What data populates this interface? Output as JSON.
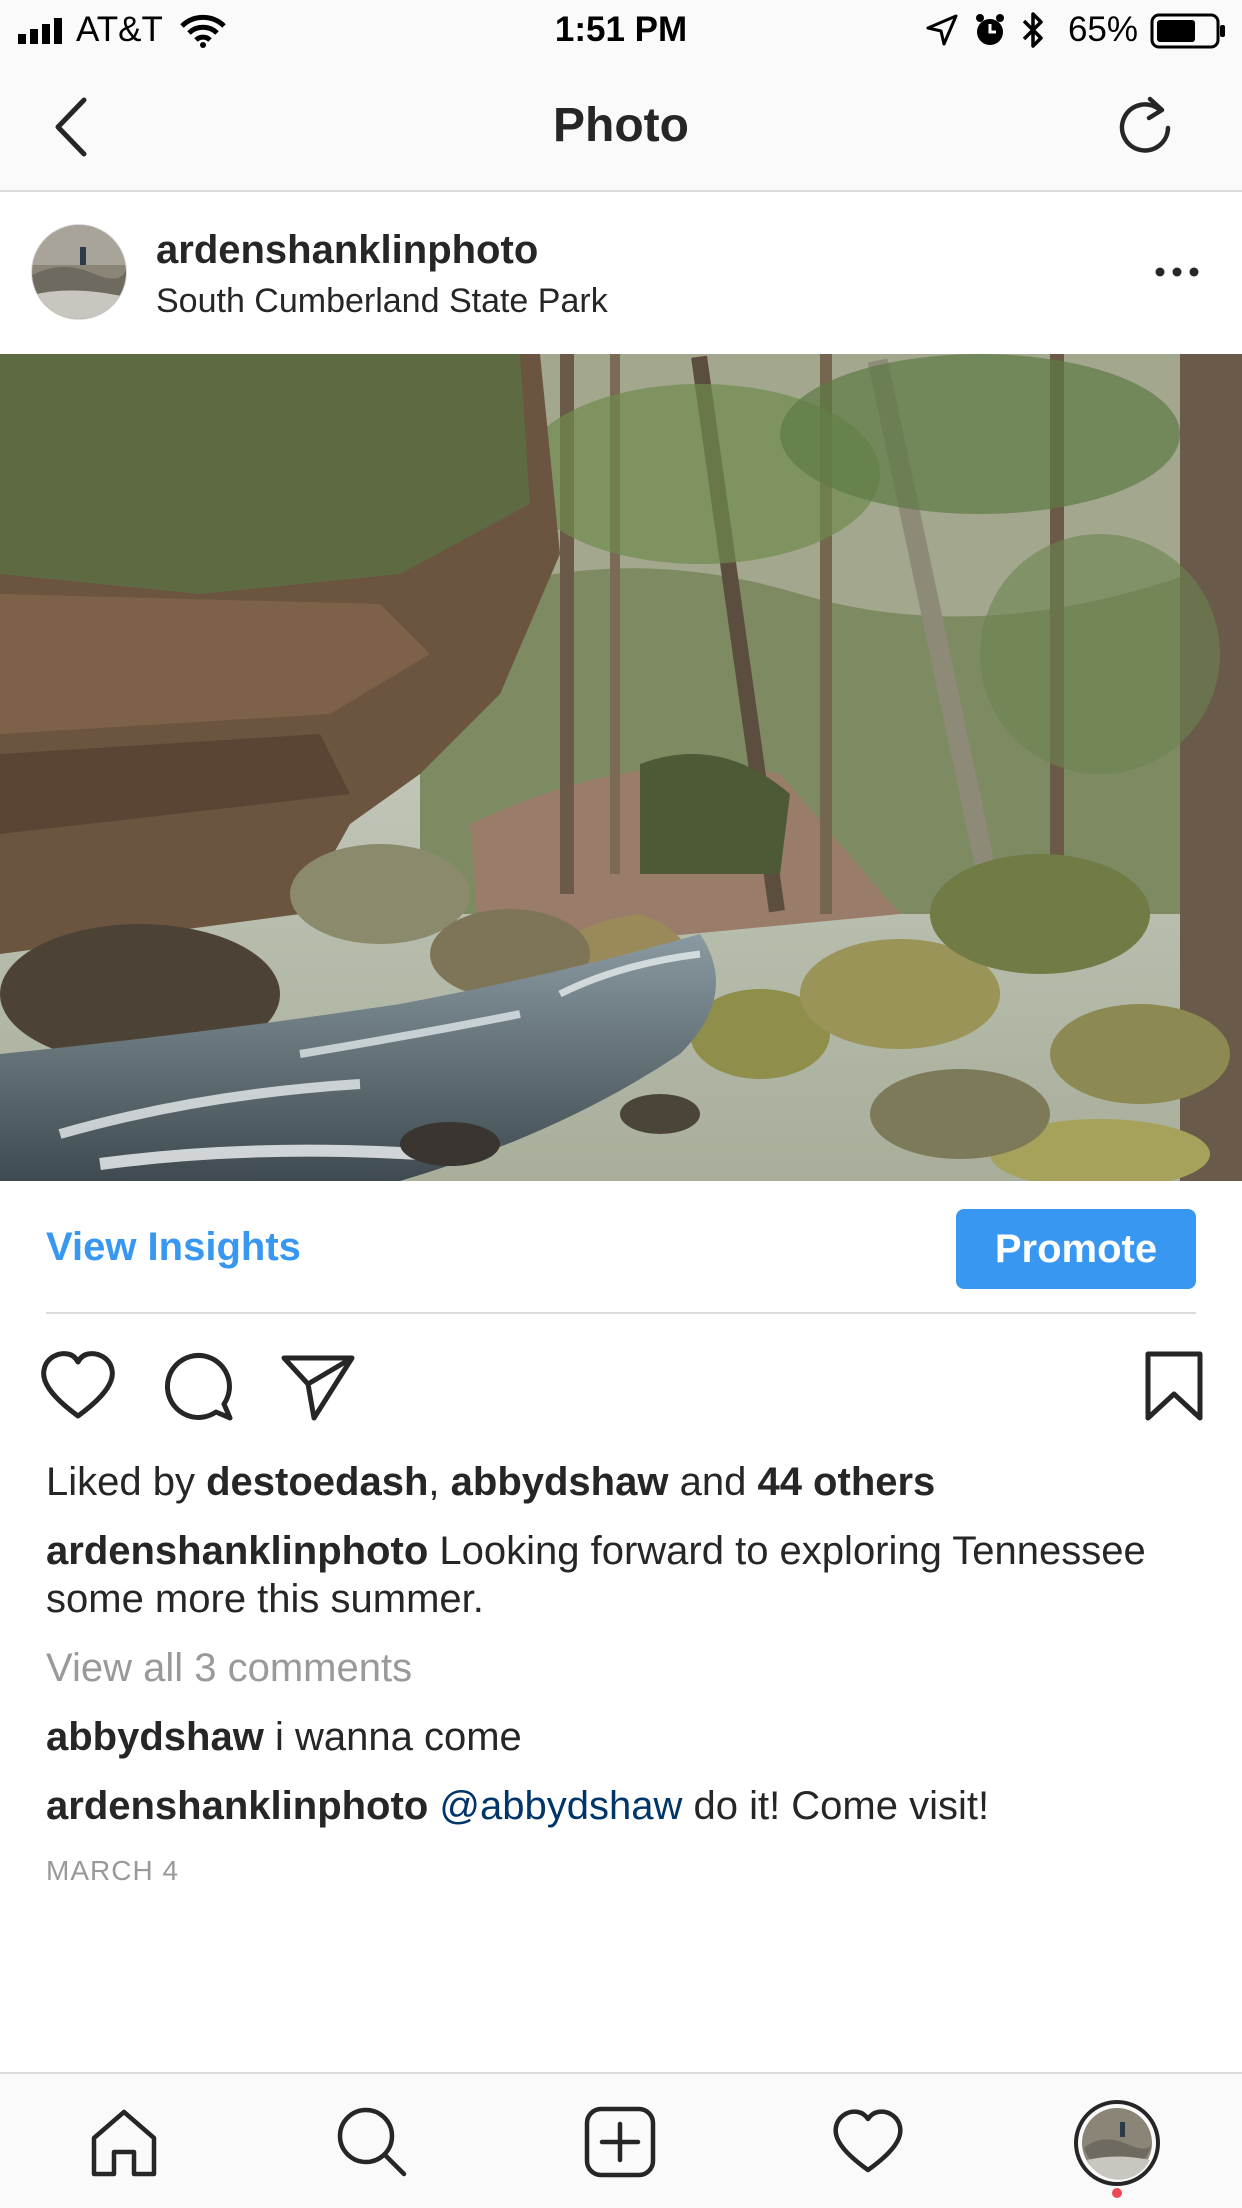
{
  "status_bar": {
    "carrier": "AT&T",
    "time": "1:51 PM",
    "battery": "65%"
  },
  "nav": {
    "title": "Photo"
  },
  "post": {
    "username": "ardenshanklinphoto",
    "location": "South Cumberland State Park",
    "photo_description": "forest creek with mossy boulders"
  },
  "insights": {
    "view_insights_label": "View Insights",
    "promote_label": "Promote"
  },
  "likes": {
    "prefix": "Liked by ",
    "user1": "destoedash",
    "sep": ", ",
    "user2": "abbydshaw",
    "and": " and ",
    "others": "44 others"
  },
  "caption": {
    "username": "ardenshanklinphoto",
    "text": " Looking forward to exploring Tennessee some more this summer."
  },
  "view_all_comments": "View all 3 comments",
  "comments": [
    {
      "username": "abbydshaw",
      "text": " i wanna come"
    },
    {
      "username": "ardenshanklinphoto",
      "mention": " @abbydshaw",
      "text": " do it! Come visit!"
    }
  ],
  "date": "MARCH 4",
  "colors": {
    "accent": "#3897f0",
    "mention": "#003569",
    "muted": "#999999",
    "text": "#262626",
    "notification_dot": "#ed4956"
  },
  "icons": {
    "back": "chevron-left-icon",
    "refresh": "refresh-icon",
    "more": "ellipsis-icon",
    "like": "heart-icon",
    "comment": "comment-icon",
    "share": "paper-plane-icon",
    "save": "bookmark-icon",
    "tab_home": "home-icon",
    "tab_search": "search-icon",
    "tab_add": "add-post-icon",
    "tab_activity": "heart-icon",
    "tab_profile": "profile-avatar-icon"
  }
}
